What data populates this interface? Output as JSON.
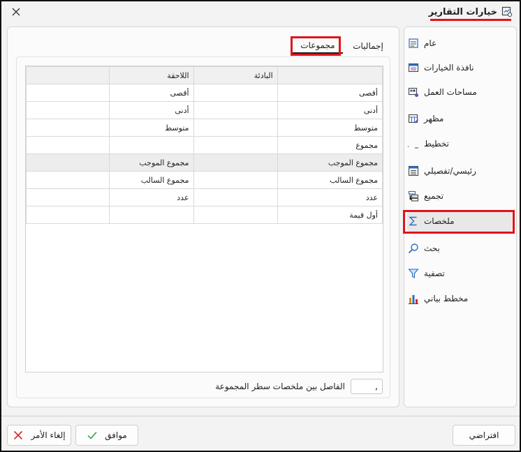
{
  "window": {
    "title": "خيارات التقارير",
    "title_icon": "report-settings-icon",
    "close_icon": "close-icon",
    "highlight_color": "#e0141a"
  },
  "sidebar": {
    "items": [
      {
        "label": "عام",
        "icon": "general-icon"
      },
      {
        "label": "نافذة الخيارات",
        "icon": "options-window-icon"
      },
      {
        "label": "مساحات العمل",
        "icon": "workspaces-icon"
      },
      {
        "label": "مظهر",
        "icon": "appearance-icon"
      },
      {
        "label": "تخطيط",
        "icon": "layout-icon"
      },
      {
        "label": "رئيسي/تفصيلي",
        "icon": "master-detail-icon"
      },
      {
        "label": "تجميع",
        "icon": "grouping-icon"
      },
      {
        "label": "ملخصات",
        "icon": "sigma-icon",
        "active": true
      },
      {
        "label": "بحث",
        "icon": "search-icon"
      },
      {
        "label": "تصفية",
        "icon": "filter-icon"
      },
      {
        "label": "مخطط بياني",
        "icon": "bar-chart-icon"
      }
    ]
  },
  "tabs": {
    "totals": "إجماليات",
    "groups": "مجموعات",
    "active": "groups"
  },
  "grid": {
    "headers": [
      "",
      "البادئة",
      "اللاحقة",
      ""
    ],
    "rows": [
      [
        "أقصى",
        "",
        "أقصى",
        ""
      ],
      [
        "أدنى",
        "",
        "أدنى",
        ""
      ],
      [
        "متوسط",
        "",
        "متوسط",
        ""
      ],
      [
        "مجموع",
        "",
        "",
        ""
      ],
      [
        "مجموع الموجب",
        "",
        "مجموع الموجب",
        ""
      ],
      [
        "مجموع السالب",
        "",
        "مجموع السالب",
        ""
      ],
      [
        "عدد",
        "",
        "عدد",
        ""
      ],
      [
        "أول قيمة",
        "",
        "",
        ""
      ]
    ]
  },
  "separator": {
    "label": "الفاصل بين ملخصات سطر المجموعة",
    "value": ","
  },
  "buttons": {
    "default": "افتراضي",
    "ok": "موافق",
    "ok_icon": "checkmark-icon",
    "cancel": "إلغاء الأمر",
    "cancel_icon": "x-icon"
  },
  "colors": {
    "accent_blue": "#2b6cc4",
    "ok_green": "#2e9e48",
    "cancel_red": "#d62b2b"
  }
}
